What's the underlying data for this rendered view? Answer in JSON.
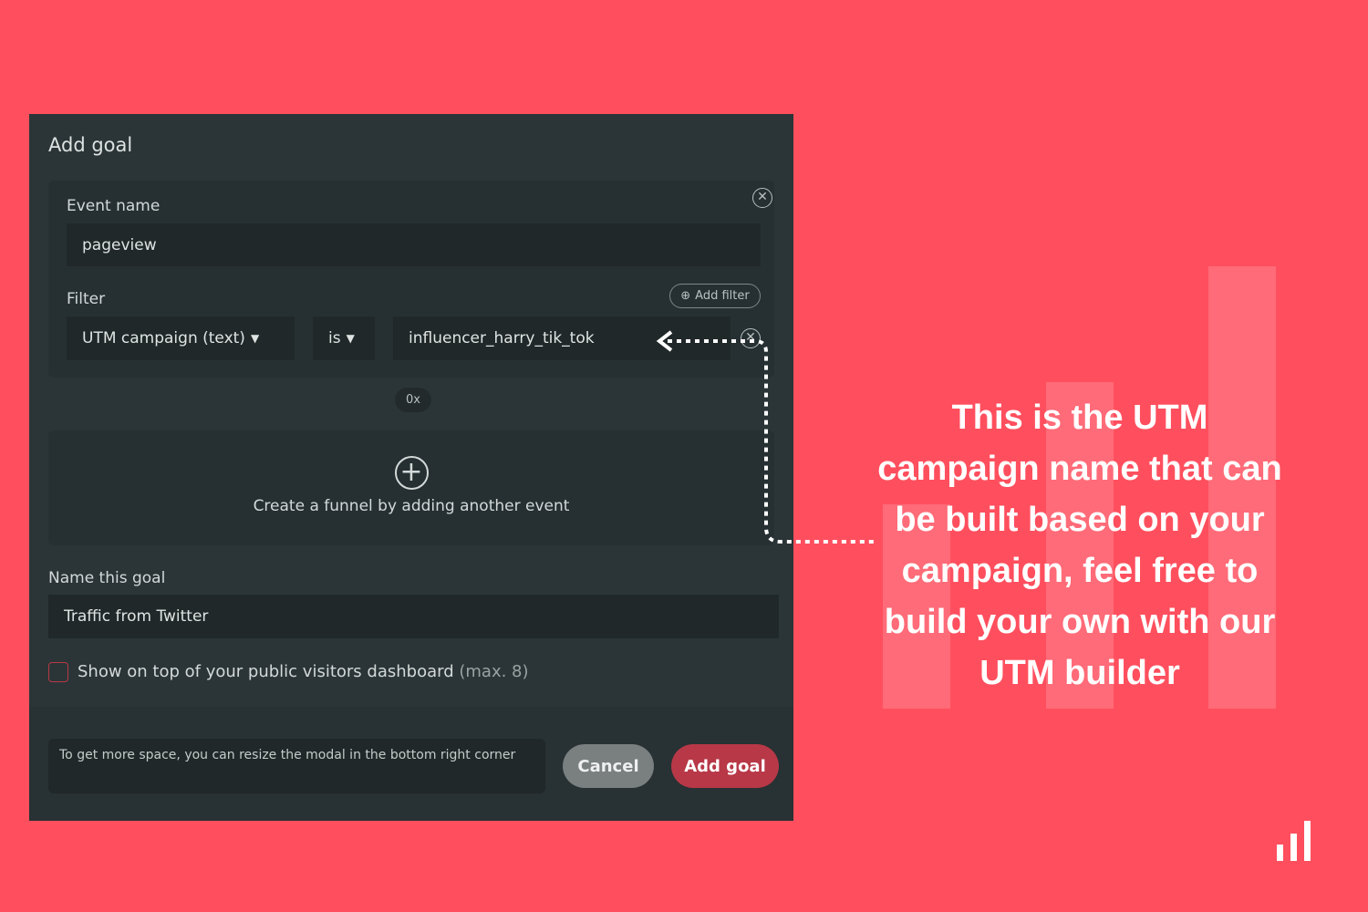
{
  "modal": {
    "title": "Add goal",
    "event_label": "Event name",
    "event_value": "pageview",
    "filter_label": "Filter",
    "add_filter": "Add filter",
    "filter_field": "UTM campaign (text)",
    "filter_operator": "is",
    "filter_value": "influencer_harry_tik_tok",
    "multiplier": "0x",
    "funnel_text": "Create a funnel by adding another event",
    "name_label": "Name this goal",
    "name_value": "Traffic from Twitter",
    "checkbox_label": "Show on top of your public visitors dashboard",
    "checkbox_note": "(max. 8)",
    "checkbox_checked": false,
    "hint": "To get more space, you can resize the modal in the bottom right corner",
    "cancel": "Cancel",
    "submit": "Add goal"
  },
  "caption": "This is the UTM campaign name that can be built based on your campaign, feel free to build your own with our UTM builder",
  "colors": {
    "background": "#ff4f5e",
    "modal": "#2b3537",
    "accent": "#b83847"
  }
}
